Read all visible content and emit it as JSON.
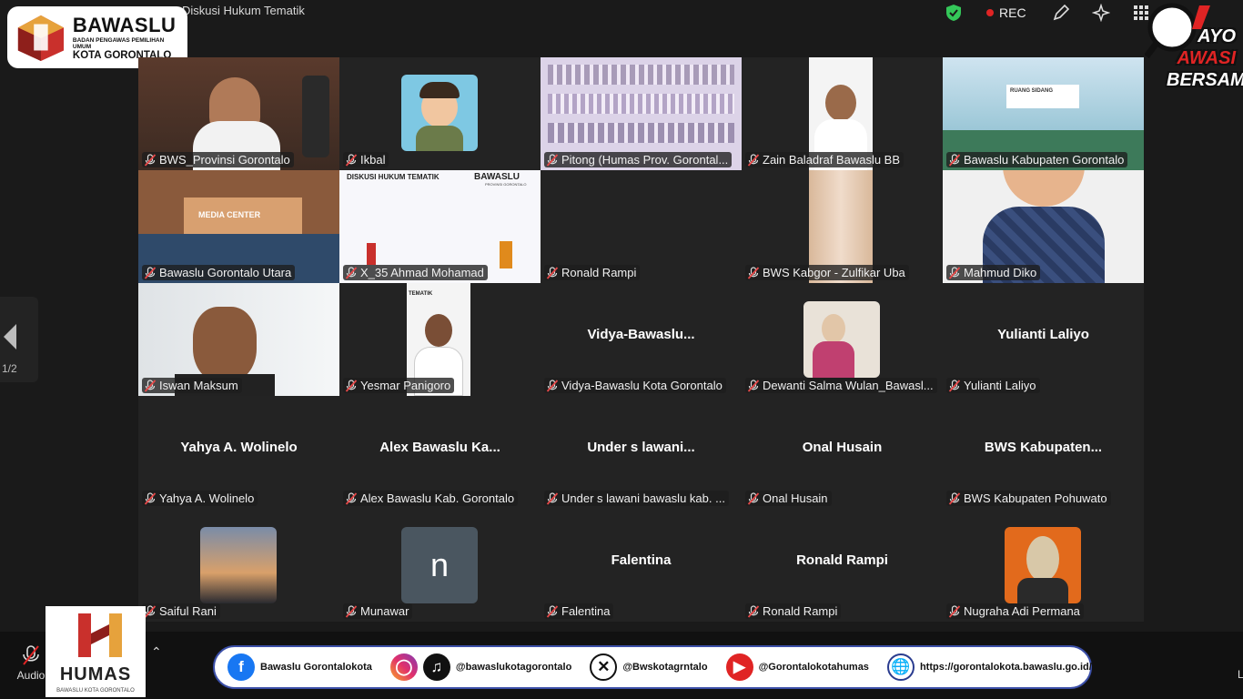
{
  "window": {
    "meeting_title": "Diskusi Hukum Tematik",
    "rec_label": "REC",
    "page_indicator": "1/2"
  },
  "logos": {
    "bawaslu": {
      "name": "BAWASLU",
      "subtitle": "BADAN PENGAWAS PEMILIHAN UMUM",
      "city": "KOTA GORONTALO"
    },
    "ayo": {
      "line1": "AYO",
      "line2": "AWASI",
      "line3": "BERSAMA"
    },
    "humas": {
      "name": "HUMAS",
      "subtitle": "BAWASLU KOTA GORONTALO"
    }
  },
  "participants": [
    {
      "label": "BWS_Provinsi Gorontalo",
      "big": "",
      "video": "office-man",
      "active": true
    },
    {
      "label": "Ikbal",
      "big": "",
      "video": "avatar-cartoon"
    },
    {
      "label": "Pitong (Humas Prov. Gorontal...",
      "big": "",
      "video": "bookshelf"
    },
    {
      "label": "Zain Baladraf Bawaslu BB",
      "big": "",
      "video": "man-portrait"
    },
    {
      "label": "Bawaslu Kabupaten Gorontalo",
      "big": "",
      "video": "meeting-room"
    },
    {
      "label": "Bawaslu Gorontalo Utara",
      "big": "",
      "video": "media-center"
    },
    {
      "label": "X_35 Ahmad Mohamad",
      "big": "",
      "video": "banner"
    },
    {
      "label": "Ronald Rampi",
      "big": "",
      "video": "blank"
    },
    {
      "label": "BWS Kabgor - Zulfikar Uba",
      "big": "",
      "video": "curtain"
    },
    {
      "label": "Mahmud Diko",
      "big": "",
      "video": "caricature"
    },
    {
      "label": "Iswan Maksum",
      "big": "",
      "video": "man-closeup"
    },
    {
      "label": "Yesmar Panigoro",
      "big": "",
      "video": "man-banner"
    },
    {
      "label": "Vidya-Bawaslu Kota Gorontalo",
      "big": "Vidya-Bawaslu...",
      "video": "none"
    },
    {
      "label": "Dewanti Salma Wulan_Bawasl...",
      "big": "",
      "video": "woman-photo"
    },
    {
      "label": "Yulianti Laliyo",
      "big": "Yulianti Laliyo",
      "video": "none"
    },
    {
      "label": "Yahya A. Wolinelo",
      "big": "Yahya A. Wolinelo",
      "video": "none"
    },
    {
      "label": "Alex Bawaslu Kab. Gorontalo",
      "big": "Alex Bawaslu Ka...",
      "video": "none"
    },
    {
      "label": "Under s lawani bawaslu kab. ...",
      "big": "Under s lawani...",
      "video": "none"
    },
    {
      "label": "Onal Husain",
      "big": "Onal Husain",
      "video": "none"
    },
    {
      "label": "BWS Kabupaten Pohuwato",
      "big": "BWS  Kabupaten...",
      "video": "none"
    },
    {
      "label": "Saiful Rani",
      "big": "",
      "video": "sunset-thumb"
    },
    {
      "label": "Munawar",
      "big": "",
      "video": "letter-thumb",
      "initial": "n"
    },
    {
      "label": "Falentina",
      "big": "Falentina",
      "video": "none"
    },
    {
      "label": "Ronald Rampi",
      "big": "Ronald Rampi",
      "video": "none"
    },
    {
      "label": "Nugraha Adi Permana",
      "big": "",
      "video": "mask-thumb"
    }
  ],
  "scene_text": {
    "banner_title": "DISKUSI HUKUM TEMATIK",
    "banner_brand": "BAWASLU",
    "banner_sub": "PROVINSI GORONTALO",
    "media_center": "MEDIA CENTER",
    "tematik": "TEMATIK",
    "ruang": "RUANG SIDANG"
  },
  "toolbar": {
    "audio_label": "Audio",
    "right_label": "L"
  },
  "social": {
    "facebook": "Bawaslu Gorontalokota",
    "tiktok": "@bawaslukotagorontalo",
    "x": "@Bwskotagrntalo",
    "youtube": "@Gorontalokotahumas",
    "website": "https://gorontalokota.bawaslu.go.id/"
  },
  "colors": {
    "accent_active": "#4fd06a",
    "rec_dot": "#e02424",
    "tile_bg": "#232323",
    "bg": "#1a1a1a"
  }
}
